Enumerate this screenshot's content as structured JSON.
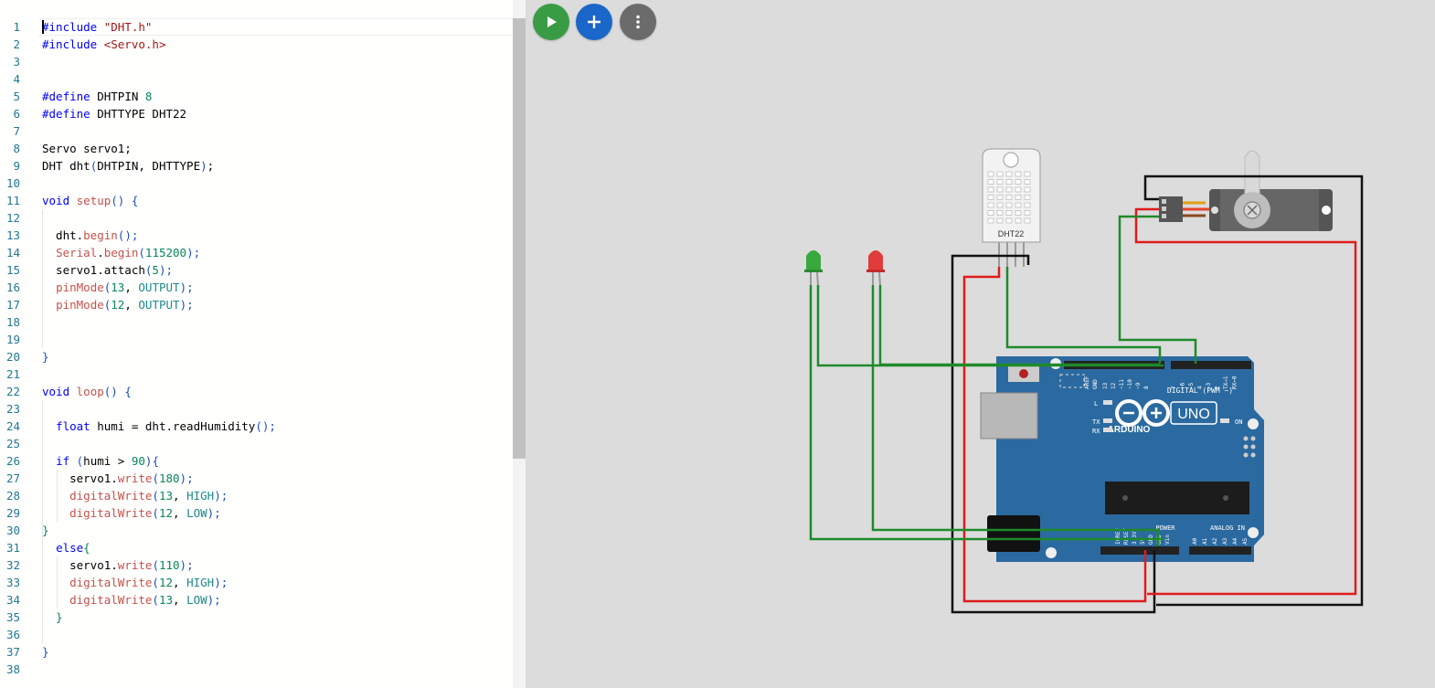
{
  "editor": {
    "lines": [
      [
        {
          "t": "#include ",
          "c": "pp"
        },
        {
          "t": "\"DHT.h\"",
          "c": "str"
        }
      ],
      [
        {
          "t": "#include ",
          "c": "pp"
        },
        {
          "t": "<Servo.h>",
          "c": "str"
        }
      ],
      [],
      [],
      [
        {
          "t": "#define ",
          "c": "pp"
        },
        {
          "t": "DHTPIN "
        },
        {
          "t": "8",
          "c": "num"
        }
      ],
      [
        {
          "t": "#define ",
          "c": "pp"
        },
        {
          "t": "DHTTYPE DHT22"
        }
      ],
      [],
      [
        {
          "t": "Servo servo1;"
        }
      ],
      [
        {
          "t": "DHT dht"
        },
        {
          "t": "(",
          "c": "pn"
        },
        {
          "t": "DHTPIN, DHTTYPE"
        },
        {
          "t": ")",
          "c": "pn"
        },
        {
          "t": ";"
        }
      ],
      [],
      [
        {
          "t": "void ",
          "c": "kw"
        },
        {
          "t": "setup",
          "c": "fn"
        },
        {
          "t": "() {",
          "c": "pn"
        }
      ],
      [],
      [
        {
          "t": "  dht."
        },
        {
          "t": "begin",
          "c": "fn"
        },
        {
          "t": "();",
          "c": "pn"
        }
      ],
      [
        {
          "t": "  "
        },
        {
          "t": "Serial",
          "c": "cls"
        },
        {
          "t": "."
        },
        {
          "t": "begin",
          "c": "fn"
        },
        {
          "t": "(",
          "c": "pn"
        },
        {
          "t": "115200",
          "c": "num"
        },
        {
          "t": ");",
          "c": "pn"
        }
      ],
      [
        {
          "t": "  servo1.attach"
        },
        {
          "t": "(",
          "c": "pn"
        },
        {
          "t": "5",
          "c": "num"
        },
        {
          "t": ");",
          "c": "pn"
        }
      ],
      [
        {
          "t": "  "
        },
        {
          "t": "pinMode",
          "c": "fn"
        },
        {
          "t": "(",
          "c": "pn"
        },
        {
          "t": "13",
          "c": "num"
        },
        {
          "t": ", "
        },
        {
          "t": "OUTPUT",
          "c": "ty"
        },
        {
          "t": ");",
          "c": "pn"
        }
      ],
      [
        {
          "t": "  "
        },
        {
          "t": "pinMode",
          "c": "fn"
        },
        {
          "t": "(",
          "c": "pn"
        },
        {
          "t": "12",
          "c": "num"
        },
        {
          "t": ", "
        },
        {
          "t": "OUTPUT",
          "c": "ty"
        },
        {
          "t": ");",
          "c": "pn"
        }
      ],
      [],
      [],
      [
        {
          "t": "}",
          "c": "pn"
        }
      ],
      [],
      [
        {
          "t": "void ",
          "c": "kw"
        },
        {
          "t": "loop",
          "c": "fn"
        },
        {
          "t": "() {",
          "c": "pn"
        }
      ],
      [],
      [
        {
          "t": "  "
        },
        {
          "t": "float ",
          "c": "kw"
        },
        {
          "t": "humi = dht.readHumidity"
        },
        {
          "t": "();",
          "c": "pn"
        }
      ],
      [],
      [
        {
          "t": "  "
        },
        {
          "t": "if ",
          "c": "kw"
        },
        {
          "t": "(",
          "c": "pn"
        },
        {
          "t": "humi > "
        },
        {
          "t": "90",
          "c": "num"
        },
        {
          "t": "){",
          "c": "pn"
        }
      ],
      [
        {
          "t": "    servo1."
        },
        {
          "t": "write",
          "c": "fn"
        },
        {
          "t": "(",
          "c": "pn"
        },
        {
          "t": "180",
          "c": "num"
        },
        {
          "t": ");",
          "c": "pn"
        }
      ],
      [
        {
          "t": "    "
        },
        {
          "t": "digitalWrite",
          "c": "fn"
        },
        {
          "t": "(",
          "c": "pn"
        },
        {
          "t": "13",
          "c": "num"
        },
        {
          "t": ", "
        },
        {
          "t": "HIGH",
          "c": "ty"
        },
        {
          "t": ");",
          "c": "pn"
        }
      ],
      [
        {
          "t": "    "
        },
        {
          "t": "digitalWrite",
          "c": "fn"
        },
        {
          "t": "(",
          "c": "pn"
        },
        {
          "t": "12",
          "c": "num"
        },
        {
          "t": ", "
        },
        {
          "t": "LOW",
          "c": "ty"
        },
        {
          "t": ");",
          "c": "pn"
        }
      ],
      [
        {
          "t": "}",
          "c": "num"
        }
      ],
      [
        {
          "t": "  "
        },
        {
          "t": "else",
          "c": "kw"
        },
        {
          "t": "{",
          "c": "num"
        }
      ],
      [
        {
          "t": "    servo1."
        },
        {
          "t": "write",
          "c": "fn"
        },
        {
          "t": "(",
          "c": "pn"
        },
        {
          "t": "110",
          "c": "num"
        },
        {
          "t": ");",
          "c": "pn"
        }
      ],
      [
        {
          "t": "    "
        },
        {
          "t": "digitalWrite",
          "c": "fn"
        },
        {
          "t": "(",
          "c": "pn"
        },
        {
          "t": "12",
          "c": "num"
        },
        {
          "t": ", "
        },
        {
          "t": "HIGH",
          "c": "ty"
        },
        {
          "t": ");",
          "c": "pn"
        }
      ],
      [
        {
          "t": "    "
        },
        {
          "t": "digitalWrite",
          "c": "fn"
        },
        {
          "t": "(",
          "c": "pn"
        },
        {
          "t": "13",
          "c": "num"
        },
        {
          "t": ", "
        },
        {
          "t": "LOW",
          "c": "ty"
        },
        {
          "t": ");",
          "c": "pn"
        }
      ],
      [
        {
          "t": "  }",
          "c": "num"
        }
      ],
      [],
      [
        {
          "t": "}",
          "c": "pn"
        }
      ],
      []
    ]
  },
  "toolbar": {
    "run_icon": "play-icon",
    "add_icon": "plus-icon",
    "more_icon": "more-vertical-icon",
    "run_color": "#3a9b45",
    "add_color": "#1a66c9",
    "more_color": "#6b6b6b"
  },
  "parts": {
    "dht22_label": "DHT22",
    "uno_label": "UNO",
    "arduino_label": "ARDUINO",
    "digital_label": "DIGITAL (PWM ~)",
    "power_label": "POWER",
    "analog_label": "ANALOG IN",
    "on_label": "ON",
    "tx_label": "TX",
    "rx_label": "RX",
    "l_label": "L",
    "aref_label": "AREF",
    "gnd_label": "GND",
    "top_pins": [
      "13",
      "12",
      "~11",
      "~10",
      "~9",
      "8",
      "7",
      "~6",
      "~5",
      "4",
      "~3",
      "2",
      "TX→1",
      "RX←0"
    ],
    "power_pins": [
      "IOREF",
      "RESET",
      "3.3V",
      "5V",
      "GND",
      "GND",
      "Vin"
    ],
    "analog_pins": [
      "A0",
      "A1",
      "A2",
      "A3",
      "A4",
      "A5"
    ]
  },
  "colors": {
    "board_blue": "#2b6aa0",
    "wire_green": "#1f8a2a",
    "wire_red": "#e01b1b",
    "wire_black": "#111111",
    "led_green": "#39a83d",
    "led_red": "#e23b3b"
  }
}
